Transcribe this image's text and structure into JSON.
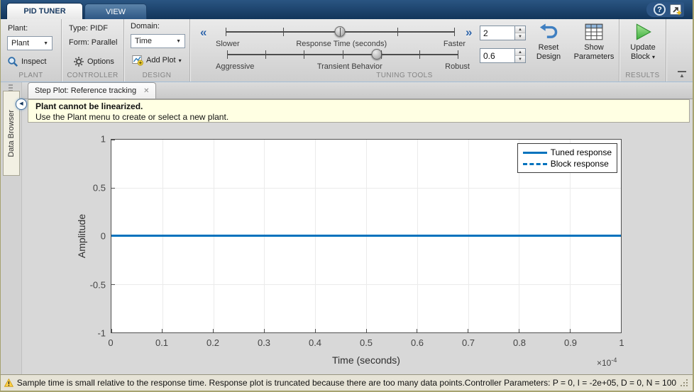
{
  "titlebar": {
    "tabs": [
      {
        "label": "PID TUNER"
      },
      {
        "label": "VIEW"
      }
    ]
  },
  "icons": {
    "help": "?",
    "close": "✕",
    "caret": "▼",
    "caret_small": "▾",
    "chevrons_left": "«",
    "chevrons_right": "»",
    "spin_up": "▲",
    "spin_down": "▼",
    "collapse_left": "◀",
    "collapse_ribbon_arrow": "▲"
  },
  "ribbon": {
    "plant": {
      "section": "PLANT",
      "field_label": "Plant:",
      "dropdown_value": "Plant",
      "inspect_label": "Inspect"
    },
    "controller": {
      "section": "CONTROLLER",
      "type_label": "Type:",
      "type_value": "PIDF",
      "form_label": "Form:",
      "form_value": "Parallel",
      "options_label": "Options"
    },
    "design": {
      "section": "DESIGN",
      "domain_label": "Domain:",
      "domain_value": "Time",
      "add_plot_label": "Add Plot"
    },
    "tuning": {
      "section": "TUNING TOOLS",
      "sliders": [
        {
          "left_label": "Slower",
          "center_label": "Response Time (seconds)",
          "right_label": "Faster",
          "ticks": 5,
          "thumb_pct": 50
        },
        {
          "left_label": "Aggressive",
          "center_label": "Transient Behavior",
          "right_label": "Robust",
          "ticks": 7,
          "thumb_pct": 65
        }
      ],
      "response_time_value": "2",
      "transient_behavior_value": "0.6",
      "reset_design_label": "Reset Design",
      "show_parameters_label": "Show Parameters"
    },
    "results": {
      "section": "RESULTS",
      "update_block_label": "Update Block"
    }
  },
  "sidebar": {
    "label": "Data Browser"
  },
  "document_tab": {
    "title": "Step Plot: Reference tracking"
  },
  "warning_banner": {
    "title": "Plant cannot be linearized.",
    "message": "Use the Plant menu to create or select a new plant."
  },
  "chart_data": {
    "type": "line",
    "title": "",
    "xlabel": "Time (seconds)",
    "ylabel": "Amplitude",
    "xlim": [
      0,
      0.0001
    ],
    "ylim": [
      -1,
      1
    ],
    "x_tick_labels": [
      "0",
      "0.1",
      "0.2",
      "0.3",
      "0.4",
      "0.5",
      "0.6",
      "0.7",
      "0.8",
      "0.9",
      "1"
    ],
    "y_tick_labels": [
      "1",
      "0.5",
      "0",
      "-0.5",
      "-1"
    ],
    "x_scale_base": "×10",
    "x_scale_exp": "-4",
    "grid": true,
    "legend_position": "top-right",
    "series": [
      {
        "name": "Tuned response",
        "line": "solid",
        "color": "#0072BD",
        "x": [
          0,
          0.0001
        ],
        "y": [
          0,
          0
        ]
      },
      {
        "name": "Block response",
        "line": "dashed",
        "color": "#0072BD",
        "x": [],
        "y": []
      }
    ]
  },
  "statusbar": {
    "message": "Sample time is small relative to the response time. Response plot is truncated because there are too many data points.",
    "controller_parameters": "Controller Parameters: P =  0, I = -2e+05, D =  0, N = 100"
  },
  "colors": {
    "matlab_blue": "#0072BD",
    "titlebar_navy": "#16395E",
    "warning_bg": "#FFFFE3",
    "ribbon_bg": "#DCDCDC",
    "canvas_bg": "#D8D8D8",
    "plot_bg": "#FFFFFF"
  }
}
